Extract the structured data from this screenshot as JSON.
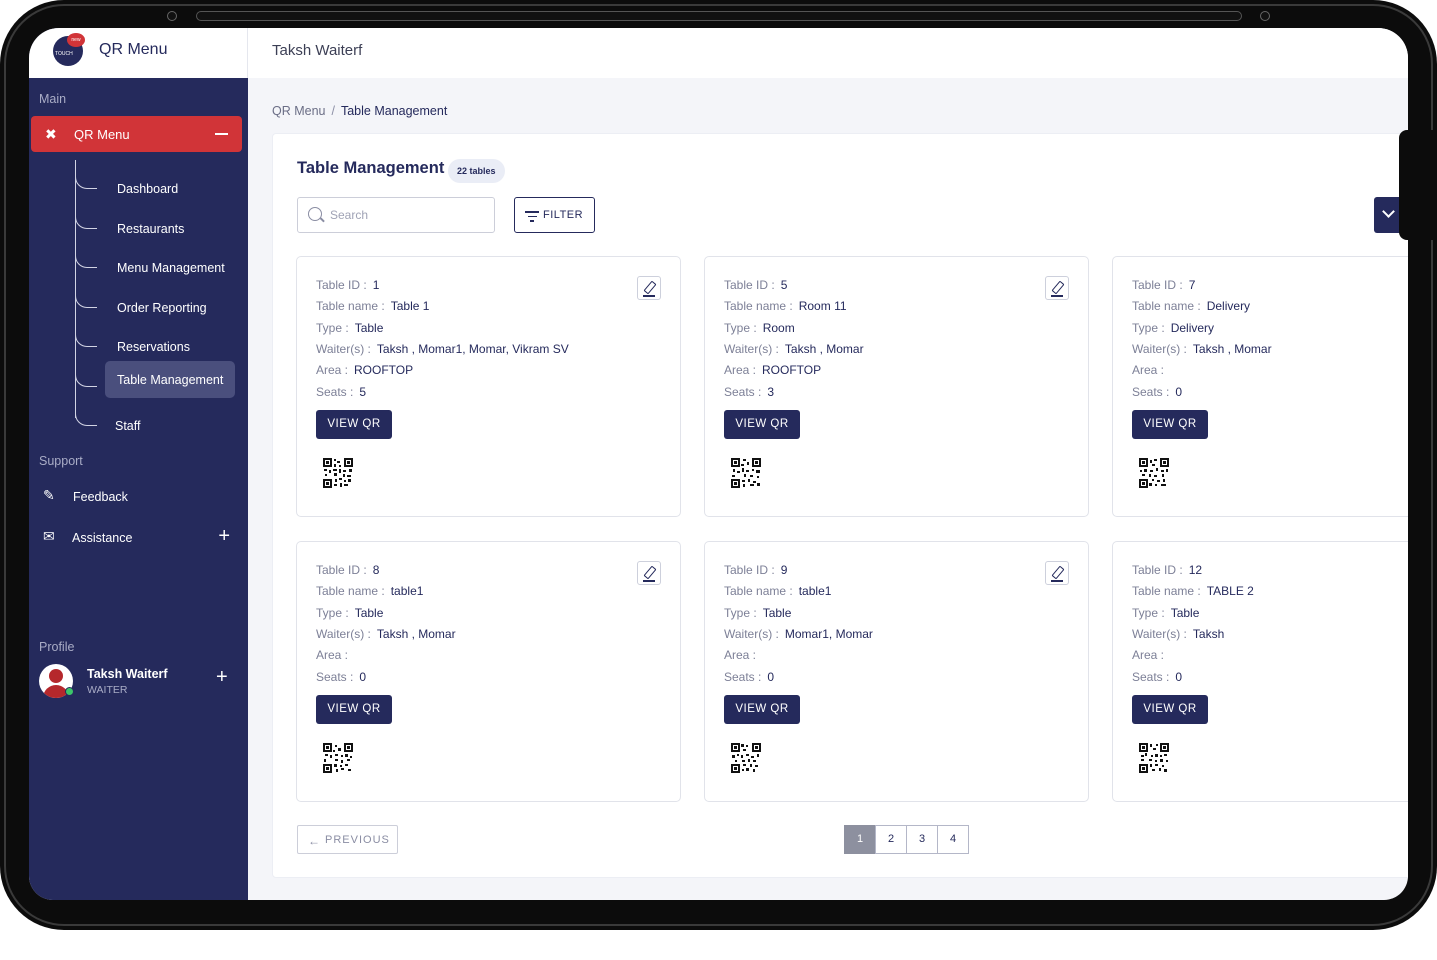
{
  "sidebar": {
    "brand": "QR Menu",
    "logo_text": "TOUCH",
    "logo_badge": "new",
    "main_label": "Main",
    "active_menu": "QR Menu",
    "sub_items": [
      {
        "label": "Dashboard",
        "active": false
      },
      {
        "label": "Restaurants",
        "active": false
      },
      {
        "label": "Menu Management",
        "active": false
      },
      {
        "label": "Order Reporting",
        "active": false
      },
      {
        "label": "Reservations",
        "active": false
      },
      {
        "label": "Table Management",
        "active": true
      },
      {
        "label": "Staff",
        "active": false
      }
    ],
    "support_label": "Support",
    "support_items": [
      {
        "label": "Feedback",
        "icon": "feedback-icon"
      },
      {
        "label": "Assistance",
        "icon": "chat-icon"
      }
    ],
    "profile_label": "Profile",
    "profile": {
      "name": "Taksh Waiterf",
      "role": "WAITER"
    }
  },
  "header": {
    "user_name": "Taksh Waiterf"
  },
  "breadcrumb": {
    "root": "QR Menu",
    "separator": "/",
    "current": "Table Management"
  },
  "page": {
    "title": "Table Management",
    "count_badge": "22 tables",
    "search_placeholder": "Search",
    "filter_label": "FILTER"
  },
  "field_labels": {
    "id": "Table ID :",
    "name": "Table name :",
    "type": "Type :",
    "waiters": "Waiter(s) :",
    "area": "Area :",
    "seats": "Seats :",
    "view_qr": "VIEW QR"
  },
  "tables": [
    {
      "id": "1",
      "name": "Table 1",
      "type": "Table",
      "waiters": "Taksh , Momar1, Momar, Vikram SV",
      "area": "ROOFTOP",
      "seats": "5"
    },
    {
      "id": "5",
      "name": "Room 11",
      "type": "Room",
      "waiters": "Taksh , Momar",
      "area": "ROOFTOP",
      "seats": "3"
    },
    {
      "id": "7",
      "name": "Delivery",
      "type": "Delivery",
      "waiters": "Taksh , Momar",
      "area": "",
      "seats": "0"
    },
    {
      "id": "8",
      "name": "table1",
      "type": "Table",
      "waiters": "Taksh , Momar",
      "area": "",
      "seats": "0"
    },
    {
      "id": "9",
      "name": "table1",
      "type": "Table",
      "waiters": "Momar1, Momar",
      "area": "",
      "seats": "0"
    },
    {
      "id": "12",
      "name": "TABLE 2",
      "type": "Table",
      "waiters": "Taksh",
      "area": "",
      "seats": "0"
    }
  ],
  "pagination": {
    "previous_label": "PREVIOUS",
    "pages": [
      "1",
      "2",
      "3",
      "4"
    ],
    "current": "1"
  },
  "colors": {
    "navy": "#252a5c",
    "accent_red": "#d13438",
    "page_bg": "#f4f5f9"
  }
}
